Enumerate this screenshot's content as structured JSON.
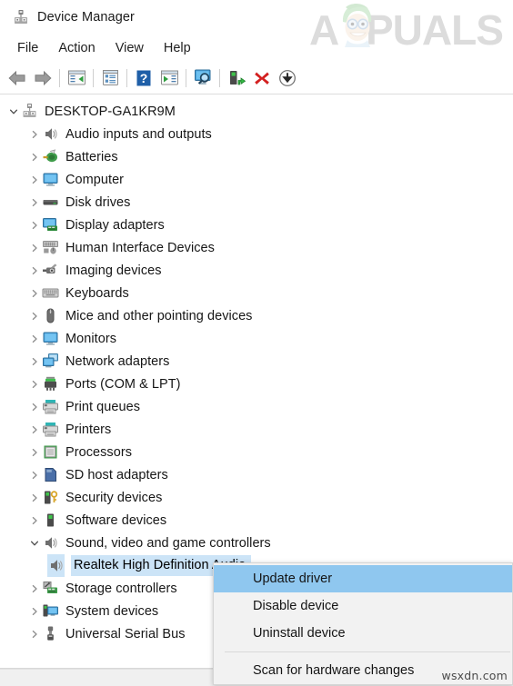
{
  "window": {
    "title": "Device Manager",
    "title_icon": "device-manager-icon"
  },
  "brand": {
    "name": "APPUALS",
    "watermark": "appuals-logo"
  },
  "menubar": {
    "items": [
      {
        "label": "File",
        "name": "menu-file"
      },
      {
        "label": "Action",
        "name": "menu-action"
      },
      {
        "label": "View",
        "name": "menu-view"
      },
      {
        "label": "Help",
        "name": "menu-help"
      }
    ]
  },
  "toolbar": {
    "buttons": [
      {
        "name": "back-button",
        "icon": "back-arrow-icon",
        "tooltip": "Back"
      },
      {
        "name": "forward-button",
        "icon": "forward-arrow-icon",
        "tooltip": "Forward"
      },
      {
        "name": "show-hide-console-tree-button",
        "icon": "console-tree-icon",
        "tooltip": "Show/Hide Console Tree"
      },
      {
        "name": "properties-button",
        "icon": "properties-icon",
        "tooltip": "Properties"
      },
      {
        "name": "help-button",
        "icon": "help-question-icon",
        "tooltip": "Help"
      },
      {
        "name": "show-hide-action-pane-button",
        "icon": "action-pane-icon",
        "tooltip": "Show/Hide Action Pane"
      },
      {
        "name": "scan-hardware-changes-button",
        "icon": "scan-monitor-icon",
        "tooltip": "Scan for hardware changes"
      },
      {
        "name": "update-driver-button",
        "icon": "update-driver-icon",
        "tooltip": "Update driver"
      },
      {
        "name": "uninstall-device-button",
        "icon": "red-x-icon",
        "tooltip": "Uninstall device"
      },
      {
        "name": "disable-device-button",
        "icon": "down-arrow-circle-icon",
        "tooltip": "Disable device"
      }
    ]
  },
  "tree": {
    "nodes": [
      {
        "label": "DESKTOP-GA1KR9M",
        "depth": 0,
        "state": "expanded",
        "icon": "computer-root-icon",
        "selected": false
      },
      {
        "label": "Audio inputs and outputs",
        "depth": 1,
        "state": "collapsed",
        "icon": "speaker-icon",
        "selected": false
      },
      {
        "label": "Batteries",
        "depth": 1,
        "state": "collapsed",
        "icon": "battery-icon",
        "selected": false
      },
      {
        "label": "Computer",
        "depth": 1,
        "state": "collapsed",
        "icon": "monitor-icon",
        "selected": false
      },
      {
        "label": "Disk drives",
        "depth": 1,
        "state": "collapsed",
        "icon": "disk-drive-icon",
        "selected": false
      },
      {
        "label": "Display adapters",
        "depth": 1,
        "state": "collapsed",
        "icon": "display-adapter-icon",
        "selected": false
      },
      {
        "label": "Human Interface Devices",
        "depth": 1,
        "state": "collapsed",
        "icon": "hid-icon",
        "selected": false
      },
      {
        "label": "Imaging devices",
        "depth": 1,
        "state": "collapsed",
        "icon": "camera-icon",
        "selected": false
      },
      {
        "label": "Keyboards",
        "depth": 1,
        "state": "collapsed",
        "icon": "keyboard-icon",
        "selected": false
      },
      {
        "label": "Mice and other pointing devices",
        "depth": 1,
        "state": "collapsed",
        "icon": "mouse-icon",
        "selected": false
      },
      {
        "label": "Monitors",
        "depth": 1,
        "state": "collapsed",
        "icon": "monitor-icon",
        "selected": false
      },
      {
        "label": "Network adapters",
        "depth": 1,
        "state": "collapsed",
        "icon": "network-adapter-icon",
        "selected": false
      },
      {
        "label": "Ports (COM & LPT)",
        "depth": 1,
        "state": "collapsed",
        "icon": "port-icon",
        "selected": false
      },
      {
        "label": "Print queues",
        "depth": 1,
        "state": "collapsed",
        "icon": "printer-icon",
        "selected": false
      },
      {
        "label": "Printers",
        "depth": 1,
        "state": "collapsed",
        "icon": "printer-icon",
        "selected": false
      },
      {
        "label": "Processors",
        "depth": 1,
        "state": "collapsed",
        "icon": "processor-icon",
        "selected": false
      },
      {
        "label": "SD host adapters",
        "depth": 1,
        "state": "collapsed",
        "icon": "sd-card-icon",
        "selected": false
      },
      {
        "label": "Security devices",
        "depth": 1,
        "state": "collapsed",
        "icon": "security-key-icon",
        "selected": false
      },
      {
        "label": "Software devices",
        "depth": 1,
        "state": "collapsed",
        "icon": "software-device-icon",
        "selected": false
      },
      {
        "label": "Sound, video and game controllers",
        "depth": 1,
        "state": "expanded",
        "icon": "speaker-icon",
        "selected": false
      },
      {
        "label": "Realtek High Definition Audio",
        "depth": 2,
        "state": "leaf",
        "icon": "speaker-icon",
        "selected": true
      },
      {
        "label": "Storage controllers",
        "depth": 1,
        "state": "collapsed",
        "icon": "storage-controller-icon",
        "selected": false
      },
      {
        "label": "System devices",
        "depth": 1,
        "state": "collapsed",
        "icon": "system-device-icon",
        "selected": false
      },
      {
        "label": "Universal Serial Bus",
        "depth": 1,
        "state": "collapsed",
        "icon": "usb-icon",
        "selected": false
      }
    ]
  },
  "context_menu": {
    "items": [
      {
        "label": "Update driver",
        "name": "ctx-update-driver",
        "highlighted": true,
        "separator_after": false
      },
      {
        "label": "Disable device",
        "name": "ctx-disable-device",
        "highlighted": false,
        "separator_after": false
      },
      {
        "label": "Uninstall device",
        "name": "ctx-uninstall-device",
        "highlighted": false,
        "separator_after": true
      },
      {
        "label": "Scan for hardware changes",
        "name": "ctx-scan-hardware-changes",
        "highlighted": false,
        "separator_after": false
      }
    ]
  },
  "watermark": {
    "source": "wsxdn.com"
  },
  "colors": {
    "selection_blue": "#cce4f7",
    "menu_highlight_blue": "#8fc7ef",
    "menu_background": "#f2f2f2",
    "window_background": "#ffffff",
    "statusbar": "#f0f0f0",
    "text": "#161616"
  }
}
